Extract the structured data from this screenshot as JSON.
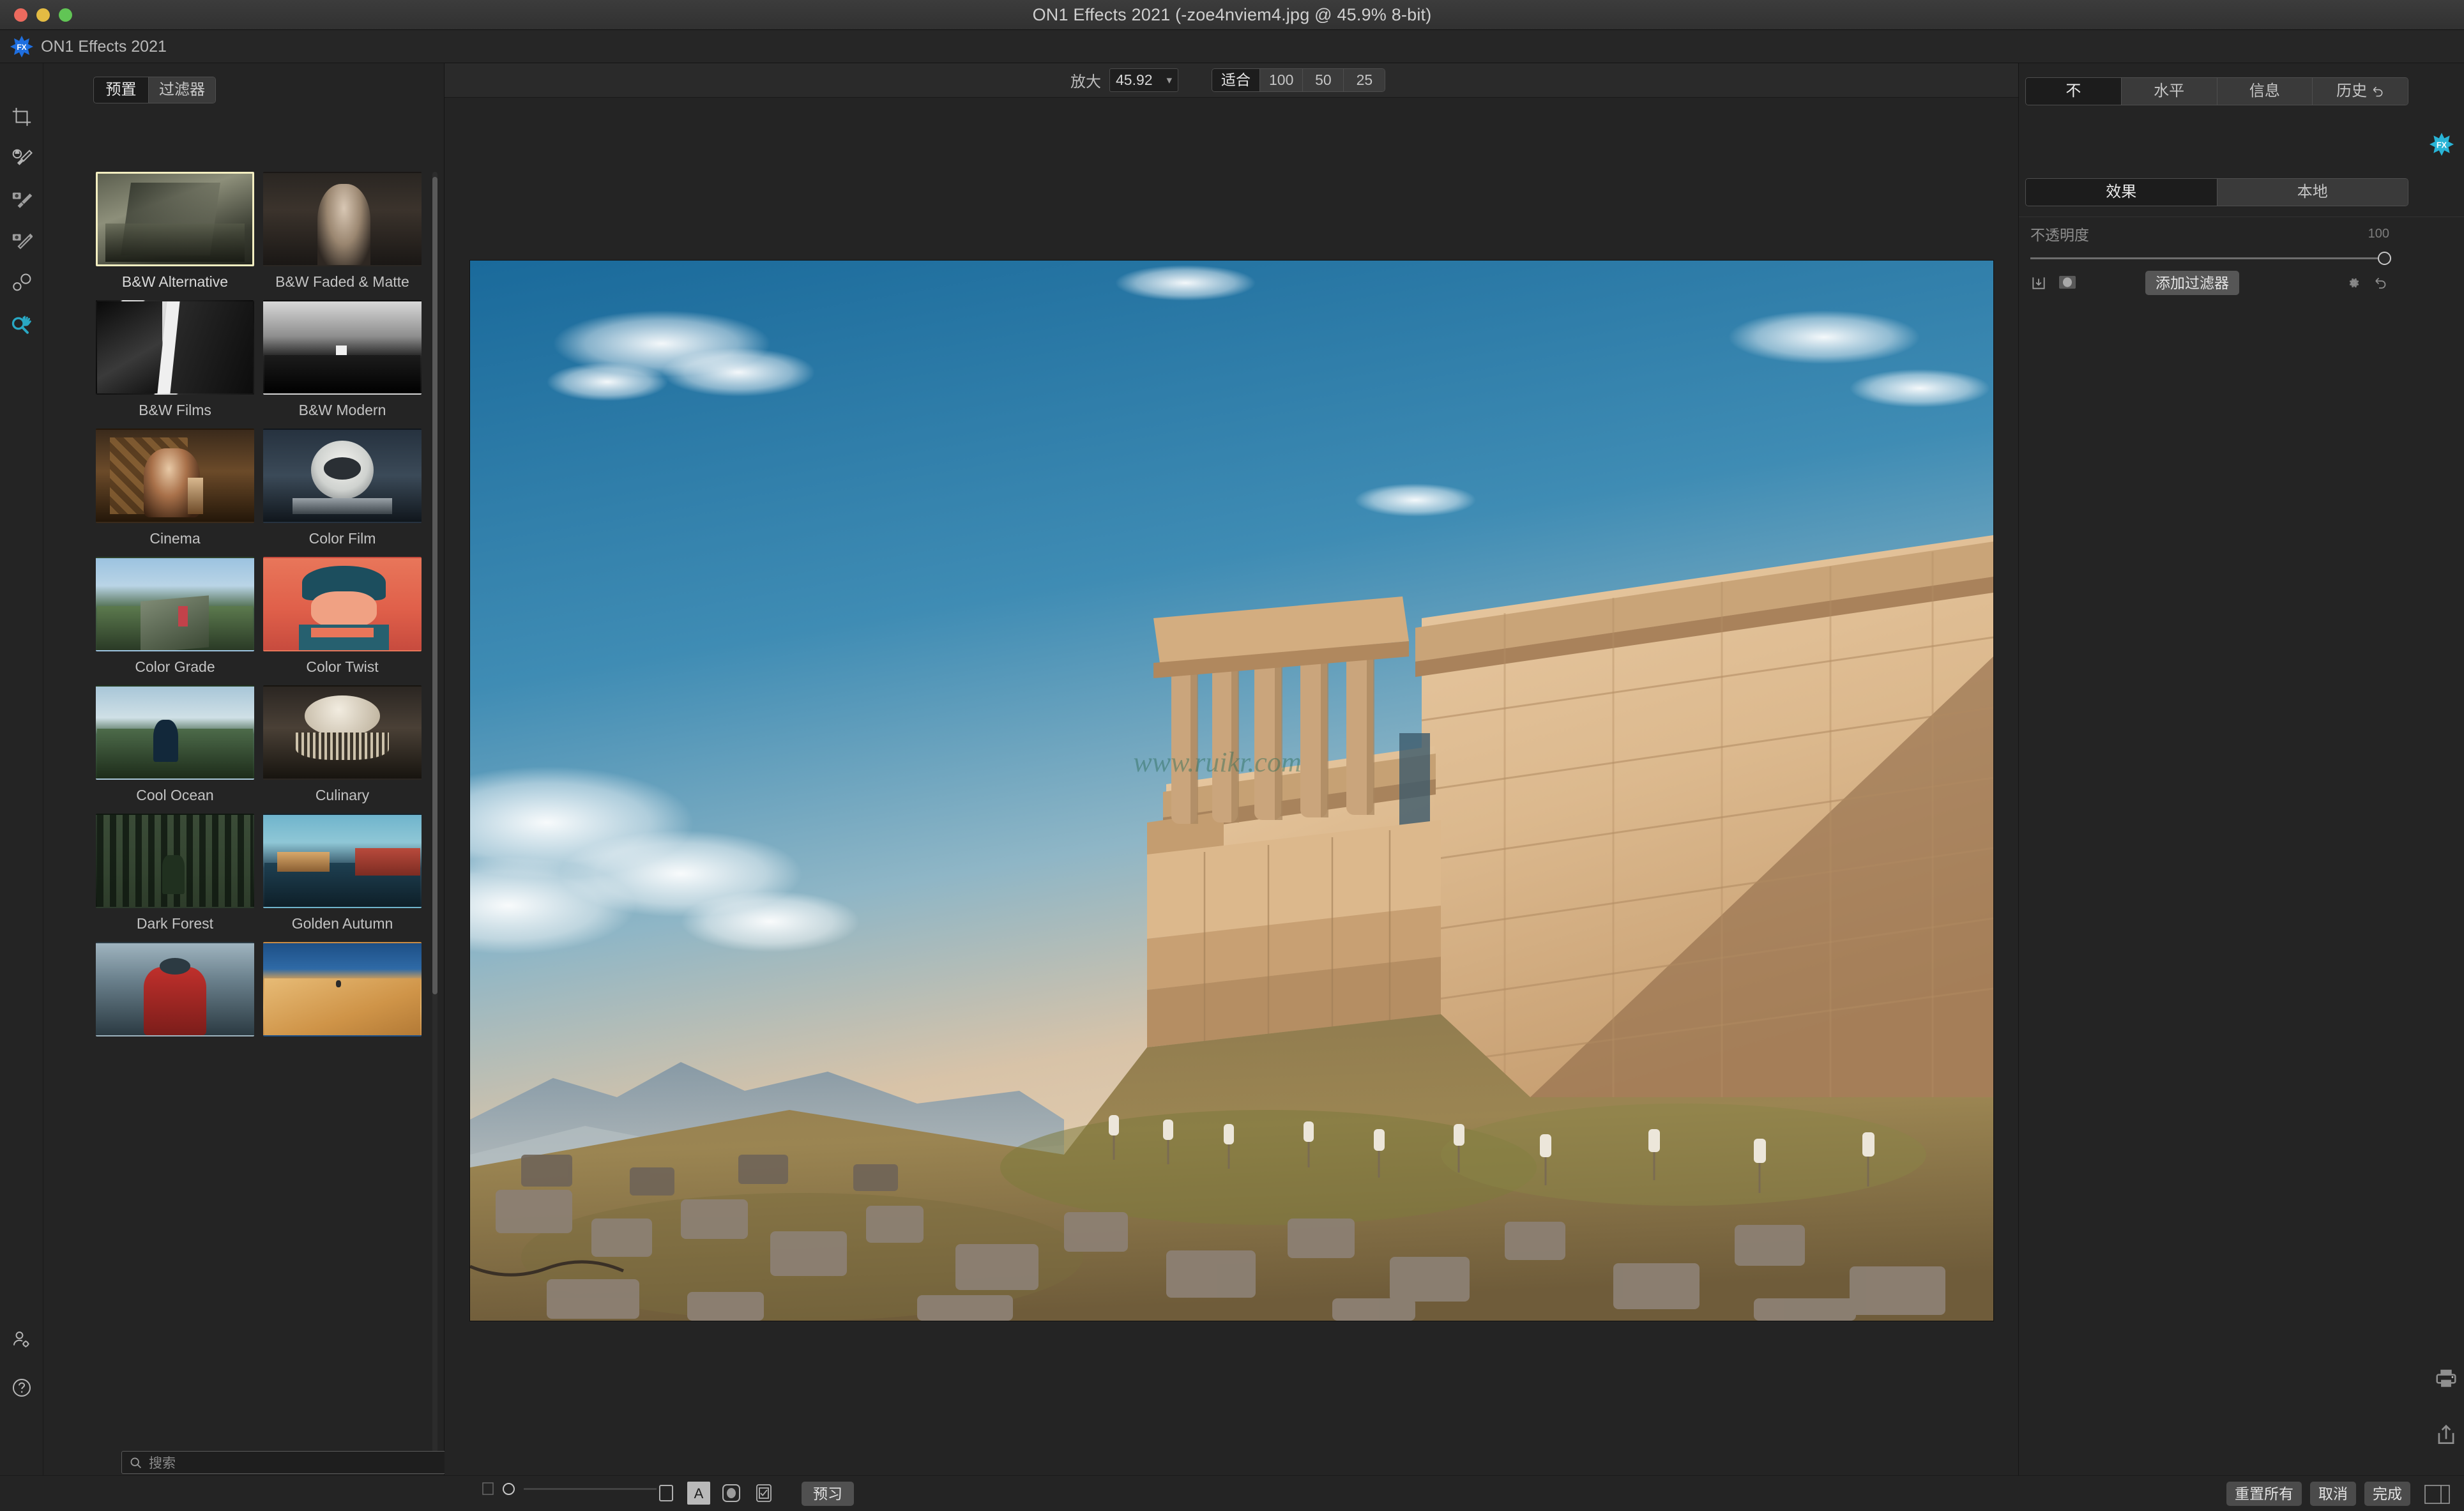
{
  "window": {
    "title": "ON1 Effects 2021 (-zoe4nviem4.jpg @ 45.9% 8-bit)",
    "app_name": "ON1 Effects 2021",
    "logo_icon": "fx-starburst-icon"
  },
  "toolbar": {
    "zoom_label": "放大",
    "zoom_value": "45.92",
    "zoom_chevron_icon": "chevron-down-icon",
    "fit_options": [
      {
        "label": "适合",
        "active": true
      },
      {
        "label": "100",
        "active": false
      },
      {
        "label": "50",
        "active": false
      },
      {
        "label": "25",
        "active": false
      }
    ]
  },
  "left_rail": {
    "tools": [
      {
        "name": "crop-tool-icon",
        "active": false
      },
      {
        "name": "perfect-brush-tool-icon",
        "active": false
      },
      {
        "name": "masking-brush-tool-icon",
        "active": false
      },
      {
        "name": "adjustable-gradient-tool-icon",
        "active": false
      },
      {
        "name": "chisel-blur-tool-icon",
        "active": false
      },
      {
        "name": "zoom-pan-tool-icon",
        "active": true
      }
    ],
    "bottom_tools": [
      {
        "name": "user-settings-icon"
      },
      {
        "name": "help-icon"
      }
    ],
    "layout_toggles": [
      {
        "name": "show-left-panel-icon",
        "active": false
      },
      {
        "name": "show-canvas-only-icon",
        "active": true
      }
    ]
  },
  "left_panel": {
    "tabs": [
      {
        "label": "预置",
        "active": true
      },
      {
        "label": "过滤器",
        "active": false
      }
    ],
    "presets": [
      {
        "label": "B&W Alternative",
        "selected": true
      },
      {
        "label": "B&W Faded & Matte",
        "selected": false
      },
      {
        "label": "B&W Films",
        "selected": false
      },
      {
        "label": "B&W Modern",
        "selected": false
      },
      {
        "label": "Cinema",
        "selected": false
      },
      {
        "label": "Color Film",
        "selected": false
      },
      {
        "label": "Color Grade",
        "selected": false
      },
      {
        "label": "Color Twist",
        "selected": false
      },
      {
        "label": "Cool Ocean",
        "selected": false
      },
      {
        "label": "Culinary",
        "selected": false
      },
      {
        "label": "Dark Forest",
        "selected": false
      },
      {
        "label": "Golden Autumn",
        "selected": false
      },
      {
        "label": "",
        "selected": false
      },
      {
        "label": "",
        "selected": false
      }
    ],
    "search": {
      "placeholder": "搜索",
      "value": "",
      "icon": "search-icon"
    }
  },
  "right_panel": {
    "tabs": [
      {
        "label": "不",
        "active": true,
        "icon": ""
      },
      {
        "label": "水平",
        "active": false,
        "icon": ""
      },
      {
        "label": "信息",
        "active": false,
        "icon": ""
      },
      {
        "label": "历史",
        "active": false,
        "icon": "undo-arrow-icon"
      }
    ],
    "sub_tabs": [
      {
        "label": "效果",
        "active": true
      },
      {
        "label": "本地",
        "active": false
      }
    ],
    "opacity": {
      "label": "不透明度",
      "value": "100"
    },
    "add_filter_label": "添加过滤器",
    "row_icons": [
      {
        "name": "save-preset-icon"
      },
      {
        "name": "mask-thumbnail-icon"
      },
      {
        "name": "gear-icon"
      },
      {
        "name": "reset-undo-icon"
      }
    ],
    "side_icons": [
      {
        "name": "print-icon"
      },
      {
        "name": "share-export-icon"
      }
    ],
    "badge_icon": "fx-starburst-icon"
  },
  "bottom_bar": {
    "filmstrip_icon": "filmstrip-icon",
    "slider_value": 0,
    "tools": [
      {
        "name": "show-mask-icon",
        "active": false
      },
      {
        "name": "text-overlay-icon",
        "active": true
      },
      {
        "name": "soft-proof-icon",
        "active": false
      },
      {
        "name": "checkbox-compare-icon",
        "active": false
      }
    ],
    "preview_label": "预习",
    "buttons": [
      {
        "label": "重置所有"
      },
      {
        "label": "取消"
      },
      {
        "label": "完成"
      }
    ],
    "layout_icon": "split-view-icon"
  },
  "colors": {
    "accent": "#29a8c4",
    "selection": "#f2edc0",
    "panel_bg": "#242424",
    "titlebar_bg": "#333333"
  }
}
